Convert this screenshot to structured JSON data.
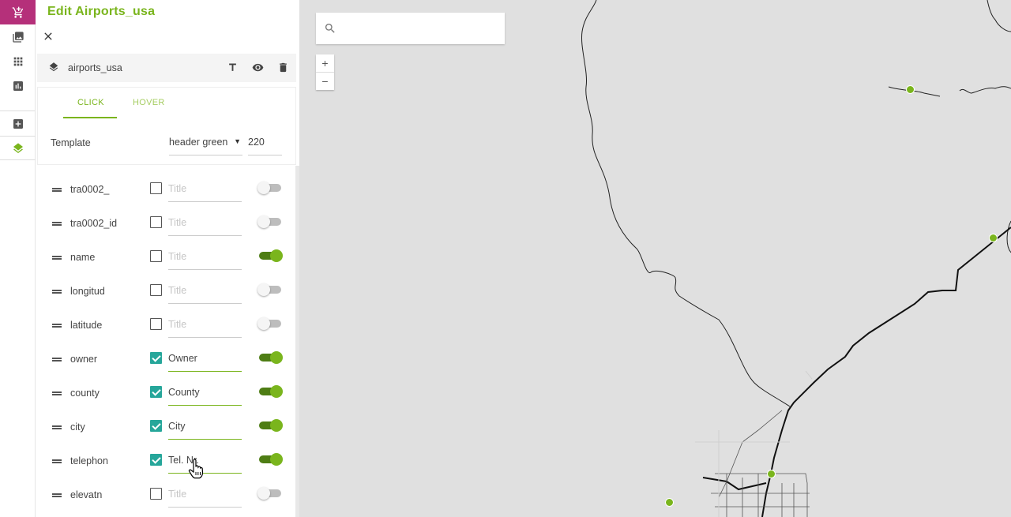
{
  "panel": {
    "title": "Edit Airports_usa",
    "layer_name": "airports_usa"
  },
  "tabs": [
    {
      "label": "CLICK"
    },
    {
      "label": "HOVER"
    }
  ],
  "template": {
    "label": "Template",
    "style": "header green",
    "width": "220"
  },
  "fields": [
    {
      "name": "tra0002_",
      "checked": false,
      "title": "",
      "placeholder": "Title",
      "visible": false
    },
    {
      "name": "tra0002_id",
      "checked": false,
      "title": "",
      "placeholder": "Title",
      "visible": false
    },
    {
      "name": "name",
      "checked": false,
      "title": "",
      "placeholder": "Title",
      "visible": true
    },
    {
      "name": "longitud",
      "checked": false,
      "title": "",
      "placeholder": "Title",
      "visible": false
    },
    {
      "name": "latitude",
      "checked": false,
      "title": "",
      "placeholder": "Title",
      "visible": false
    },
    {
      "name": "owner",
      "checked": true,
      "title": "Owner",
      "placeholder": "Title",
      "visible": true
    },
    {
      "name": "county",
      "checked": true,
      "title": "County",
      "placeholder": "Title",
      "visible": true
    },
    {
      "name": "city",
      "checked": true,
      "title": "City",
      "placeholder": "Title",
      "visible": true
    },
    {
      "name": "telephon",
      "checked": true,
      "title": "Tel. Nr.",
      "placeholder": "Title",
      "visible": true
    },
    {
      "name": "elevatn",
      "checked": false,
      "title": "",
      "placeholder": "Title",
      "visible": false
    }
  ],
  "map": {
    "search_placeholder": "",
    "zoom_in": "+",
    "zoom_out": "−"
  },
  "colors": {
    "accent": "#7ab51d",
    "brand": "#b5307a",
    "checkbox": "#26a69a"
  }
}
